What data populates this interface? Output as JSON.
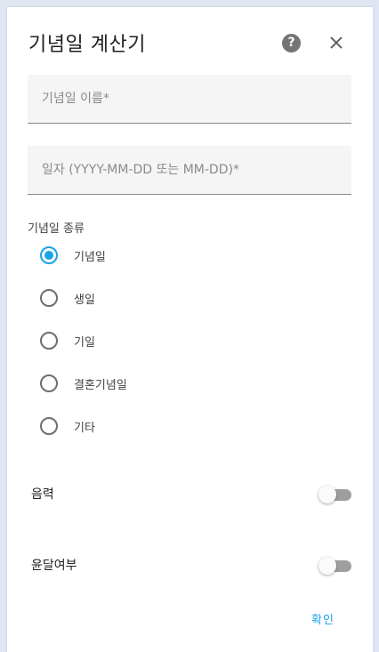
{
  "dialog": {
    "title": "기념일 계산기",
    "help_icon": "help-circle-icon",
    "close_icon": "close-icon"
  },
  "form": {
    "name_field": {
      "placeholder": "기념일 이름*",
      "value": ""
    },
    "date_field": {
      "placeholder": "일자 (YYYY-MM-DD 또는 MM-DD)*",
      "value": ""
    },
    "type_label": "기념일 종류",
    "type_options": [
      {
        "label": "기념일",
        "checked": true
      },
      {
        "label": "생일",
        "checked": false
      },
      {
        "label": "기일",
        "checked": false
      },
      {
        "label": "결혼기념일",
        "checked": false
      },
      {
        "label": "기타",
        "checked": false
      }
    ],
    "lunar_toggle": {
      "label": "음력",
      "on": false
    },
    "leap_month_toggle": {
      "label": "윤달여부",
      "on": false
    }
  },
  "actions": {
    "confirm_label": "확인"
  },
  "colors": {
    "accent": "#1aa3e8",
    "background": "#dfe6f2",
    "field_bg": "#f5f5f5"
  }
}
